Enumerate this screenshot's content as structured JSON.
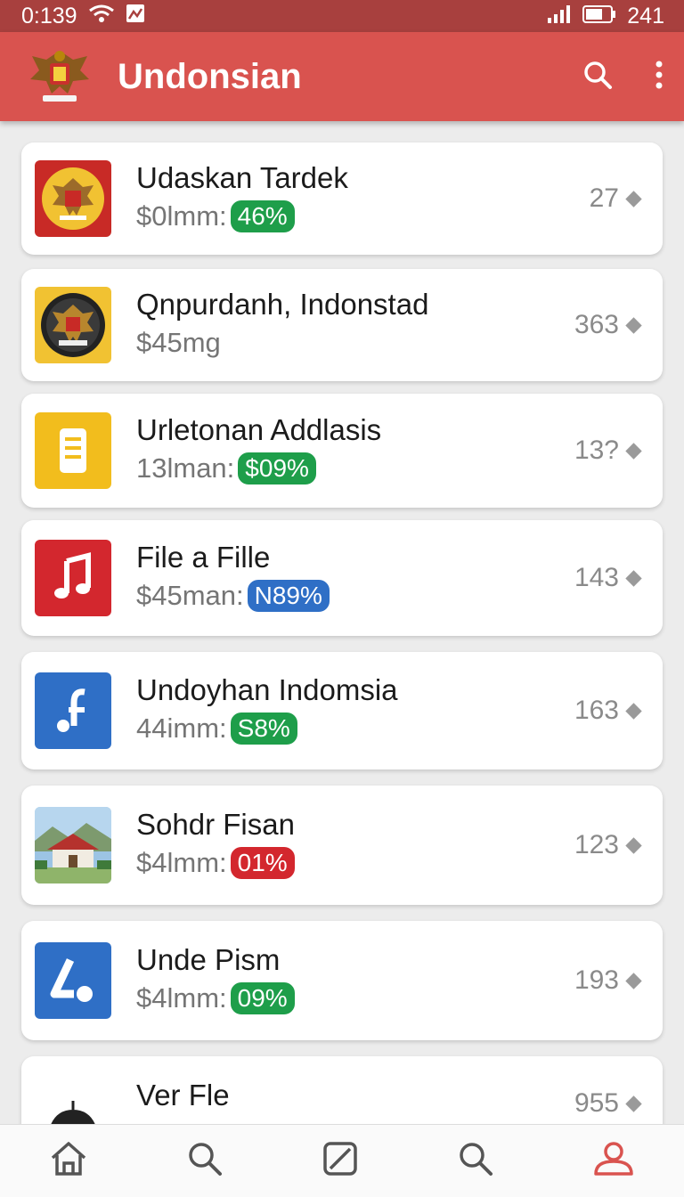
{
  "status_bar": {
    "time": "0:139",
    "battery": "241"
  },
  "app_bar": {
    "title": "Undonsian"
  },
  "colors": {
    "accent": "#d9534f",
    "status": "#a8403e",
    "green": "#1e9e4a",
    "blue": "#2f6fc6",
    "red": "#d3272e"
  },
  "items": [
    {
      "title": "Udaskan Tardek",
      "subtitle": "$0lmm:",
      "badge": "46%",
      "badge_color": "#1e9e4a",
      "count": "27",
      "icon": "emblem-icon"
    },
    {
      "title": "Qnpurdanh, Indonstad",
      "subtitle": "$45mg",
      "badge": "",
      "badge_color": "",
      "count": "363",
      "icon": "emblem-icon"
    },
    {
      "title": "Urletonan Addlasis",
      "subtitle": "13lman:",
      "badge": "$09%",
      "badge_color": "#1e9e4a",
      "count": "13?",
      "icon": "document-icon"
    },
    {
      "title": "File a Fille",
      "subtitle": "$45man:",
      "badge": "N89%",
      "badge_color": "#2f6fc6",
      "count": "143",
      "icon": "music-note-icon"
    },
    {
      "title": "Undoyhan Indomsia",
      "subtitle": "44imm:",
      "badge": "S8%",
      "badge_color": "#1e9e4a",
      "count": "163",
      "icon": "music-app-icon"
    },
    {
      "title": "Sohdr Fisan",
      "subtitle": "$4lmm:",
      "badge": "01%",
      "badge_color": "#d3272e",
      "count": "123",
      "icon": "house-photo-icon"
    },
    {
      "title": "Unde Pism",
      "subtitle": "$4lmm:",
      "badge": "09%",
      "badge_color": "#1e9e4a",
      "count": "193",
      "icon": "drive-icon"
    },
    {
      "title": "Ver Fle",
      "subtitle": "",
      "badge": "",
      "badge_color": "",
      "count": "955",
      "icon": "dome-icon"
    }
  ],
  "bottom_nav": [
    {
      "name": "home-icon"
    },
    {
      "name": "search-icon"
    },
    {
      "name": "edit-icon"
    },
    {
      "name": "search-icon"
    },
    {
      "name": "profile-icon"
    }
  ]
}
